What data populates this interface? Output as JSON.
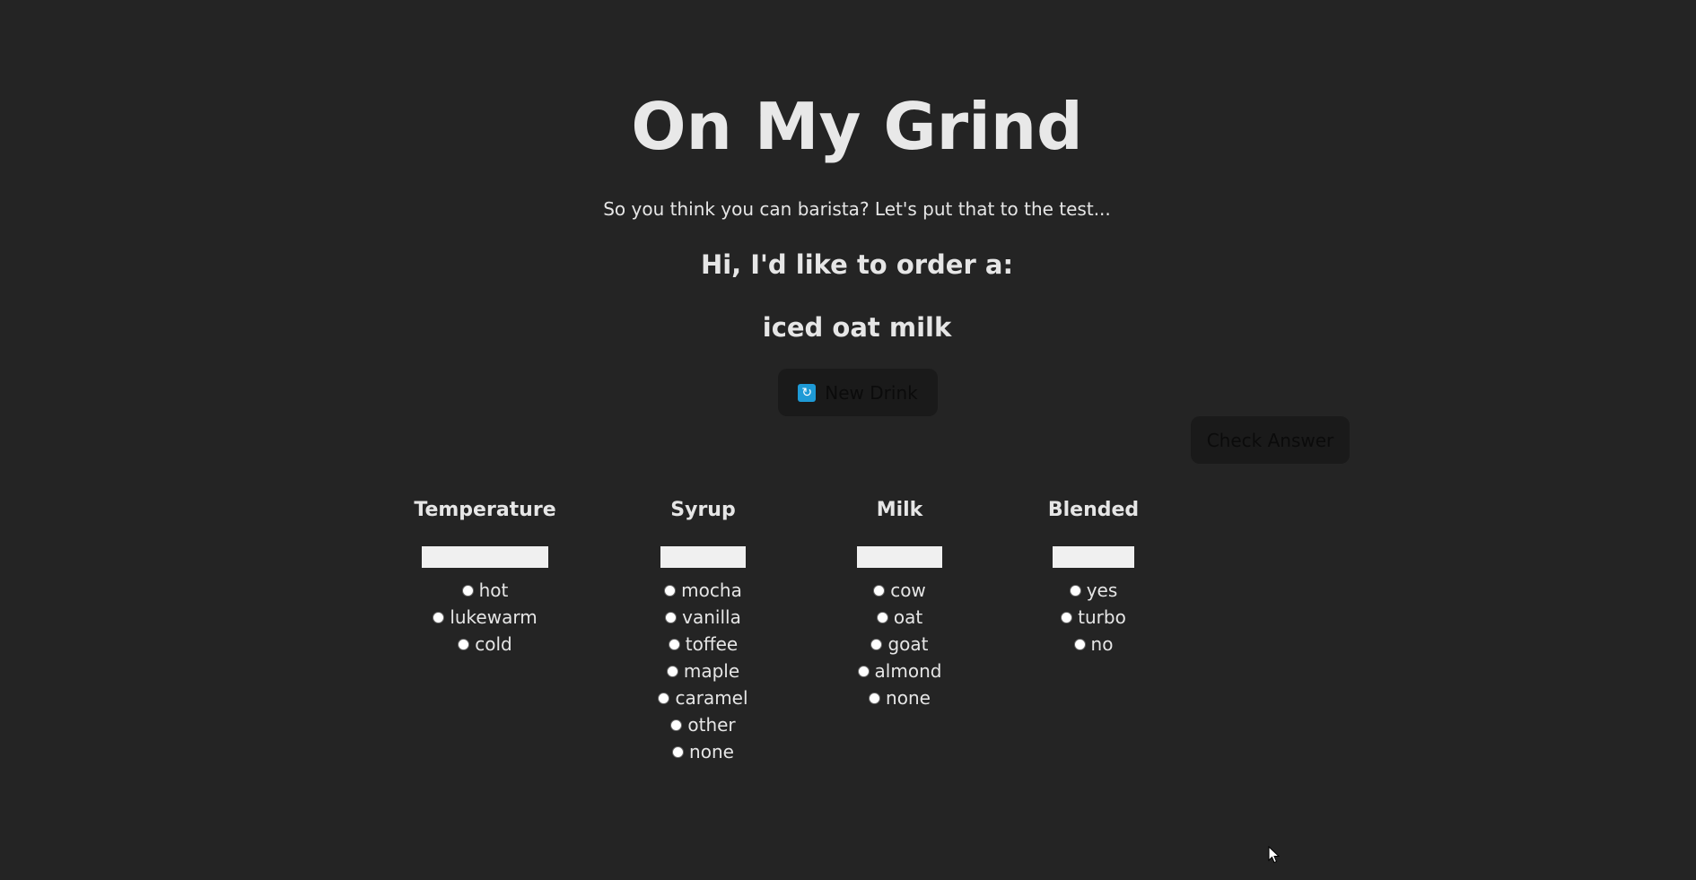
{
  "header": {
    "title": "On My Grind",
    "tagline": "So you think you can barista? Let's put that to the test...",
    "order_prompt": "Hi, I'd like to order a:",
    "order_drink": "iced oat milk"
  },
  "buttons": {
    "new_drink_label": "New Drink",
    "new_drink_icon": "refresh-icon",
    "check_answer_label": "Check Answer"
  },
  "columns": {
    "temperature": {
      "heading": "Temperature",
      "input_value": "",
      "options": [
        "hot",
        "lukewarm",
        "cold"
      ]
    },
    "syrup": {
      "heading": "Syrup",
      "input_value": "",
      "options": [
        "mocha",
        "vanilla",
        "toffee",
        "maple",
        "caramel",
        "other",
        "none"
      ]
    },
    "milk": {
      "heading": "Milk",
      "input_value": "",
      "options": [
        "cow",
        "oat",
        "goat",
        "almond",
        "none"
      ]
    },
    "blended": {
      "heading": "Blended",
      "input_value": "",
      "options": [
        "yes",
        "turbo",
        "no"
      ]
    }
  },
  "colors": {
    "background": "#242424",
    "text": "#e6e6e6",
    "button_bg": "#1a1a1a",
    "icon_accent": "#1e9ad6"
  }
}
